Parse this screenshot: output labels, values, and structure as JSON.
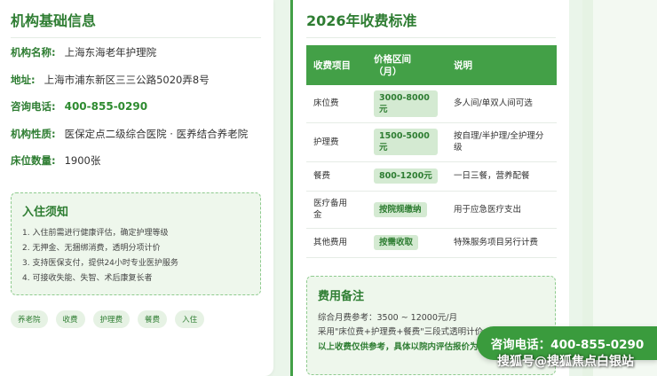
{
  "basic_info": {
    "title": "机构基础信息",
    "rows": [
      {
        "label": "机构名称:",
        "value": "上海东海老年护理院"
      },
      {
        "label": "地址:",
        "value": "上海市浦东新区三三公路5020弄8号"
      },
      {
        "label": "咨询电话:",
        "value": "400-855-0290"
      },
      {
        "label": "机构性质:",
        "value": "医保定点二级综合医院 · 医养结合养老院"
      },
      {
        "label": "床位数量:",
        "value": "1900张"
      }
    ]
  },
  "notice": {
    "title": "入住须知",
    "items": [
      "1. 入住前需进行健康评估，确定护理等级",
      "2. 无押金、无捆绑消费，透明分项计价",
      "3. 支持医保支付，提供24小时专业医护服务",
      "4. 可接收失能、失智、术后康复长者"
    ]
  },
  "tags": [
    "养老院",
    "收费",
    "护理费",
    "餐费",
    "入住"
  ],
  "fees": {
    "title": "2026年收费标准",
    "headers": [
      "收费项目",
      "价格区间\n（月）",
      "说明"
    ],
    "rows": [
      {
        "item": "床位费",
        "price": "3000-8000元",
        "desc": "多人间/单双人间可选"
      },
      {
        "item": "护理费",
        "price": "1500-5000元",
        "desc": "按自理/半护理/全护理分级"
      },
      {
        "item": "餐费",
        "price": "800-1200元",
        "desc": "一日三餐，营养配餐"
      },
      {
        "item": "医疗备用金",
        "price": "按院规缴纳",
        "desc": "用于应急医疗支出"
      },
      {
        "item": "其他费用",
        "price": "按需收取",
        "desc": "特殊服务项目另行计费"
      }
    ]
  },
  "fee_note": {
    "title": "费用备注",
    "line1": "综合月费参考：3500 ~ 12000元/月",
    "line2": "采用\"床位费+护理费+餐费\"三段式透明计价",
    "line3": "以上收费仅供参考，具体以院内评估报价为准"
  },
  "float_button": {
    "label": "咨询电话：400-855-0290"
  },
  "watermark": "搜狐号@搜狐焦点白银站",
  "colors": {
    "accent": "#43a047",
    "title_green": "#2e7d32",
    "panel_bg": "#eef7ec"
  }
}
